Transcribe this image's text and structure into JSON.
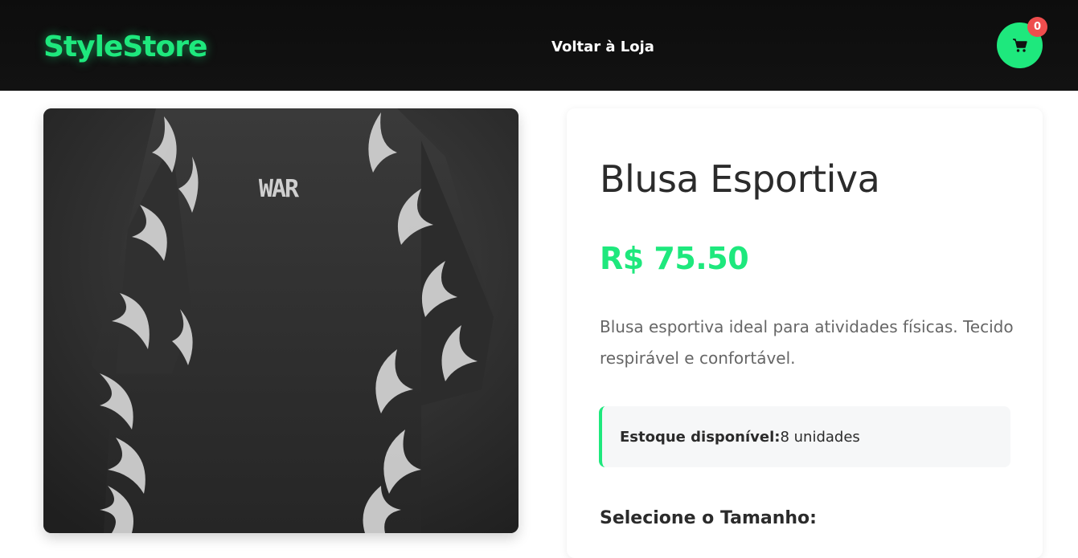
{
  "header": {
    "logo": "StyleStore",
    "back_link": "Voltar à Loja",
    "cart_count": "0"
  },
  "product": {
    "image_alt": "Blusa Esportiva",
    "image_print": "WAR",
    "title": "Blusa Esportiva",
    "price": "R$ 75.50",
    "description": "Blusa esportiva ideal para atividades físicas. Tecido respirável e confortável.",
    "stock_label": "Estoque disponível:",
    "stock_value": " 8 unidades",
    "size_heading": "Selecione o Tamanho:"
  },
  "colors": {
    "accent": "#1ee87d",
    "badge": "#ee4d4d",
    "header_bg": "#0d0d0d"
  },
  "icons": {
    "cart": "shopping-cart-icon"
  }
}
